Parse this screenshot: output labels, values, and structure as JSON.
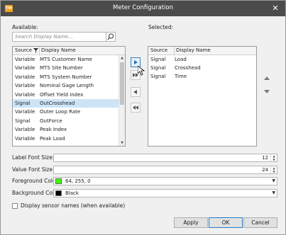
{
  "window": {
    "title": "Meter Configuration",
    "app_icon": "app-logo-icon"
  },
  "available": {
    "label": "Available:",
    "search_placeholder": "Search Display Name...",
    "columns": [
      "Source",
      "Display Name"
    ],
    "rows": [
      {
        "source": "Variable",
        "name": "MTS Customer Name"
      },
      {
        "source": "Variable",
        "name": "MTS Site Number"
      },
      {
        "source": "Variable",
        "name": "MTS System Number"
      },
      {
        "source": "Variable",
        "name": "Nominal Gage Length"
      },
      {
        "source": "Variable",
        "name": "Offset Yield Index"
      },
      {
        "source": "Signal",
        "name": "OutCrosshead"
      },
      {
        "source": "Variable",
        "name": "Outer Loop Rate"
      },
      {
        "source": "Signal",
        "name": "OutForce"
      },
      {
        "source": "Variable",
        "name": "Peak Index"
      },
      {
        "source": "Variable",
        "name": "Peak Load"
      }
    ],
    "selected_row": 5
  },
  "selected": {
    "label": "Selected:",
    "columns": [
      "Source",
      "Display Name"
    ],
    "rows": [
      {
        "source": "Signal",
        "name": "Load"
      },
      {
        "source": "Signal",
        "name": "Crosshead"
      },
      {
        "source": "Signal",
        "name": "Time"
      }
    ]
  },
  "settings": {
    "label_font_size_label": "Label Font Size:",
    "label_font_size": "12",
    "value_font_size_label": "Value Font Size:",
    "value_font_size": "24",
    "foreground_label": "Foreground Color:",
    "foreground_value": "64, 255, 0",
    "foreground_hex": "#40ff00",
    "background_label": "Background Color:",
    "background_value": "Black",
    "background_hex": "#000000",
    "sensor_names_label": "Display sensor names (when available)"
  },
  "buttons": {
    "apply": "Apply",
    "ok": "OK",
    "cancel": "Cancel"
  }
}
